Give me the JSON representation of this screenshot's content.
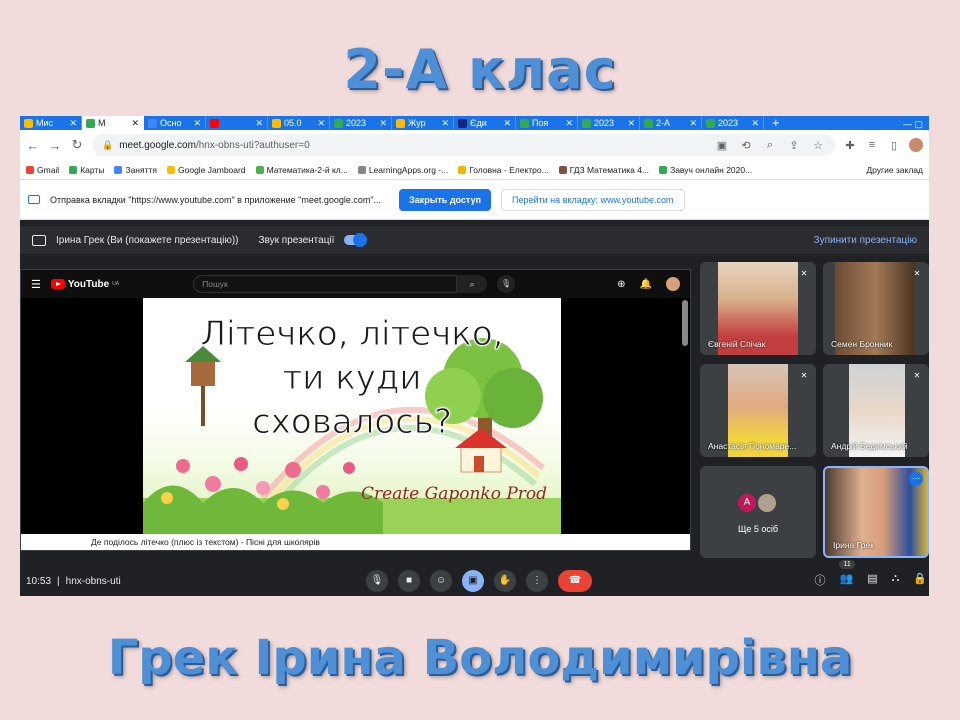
{
  "slide": {
    "title": "2-А клас",
    "footer": "Грек Ірина Володимирівна"
  },
  "browser": {
    "tabs": [
      {
        "label": "Мис",
        "color": "#fbbc04",
        "active": false
      },
      {
        "label": "M",
        "color": "#34a853",
        "active": true
      },
      {
        "label": "Осно",
        "color": "#4285f4",
        "active": false
      },
      {
        "label": "",
        "color": "#ff0000",
        "active": false
      },
      {
        "label": "05.0",
        "color": "#fbbc04",
        "active": false
      },
      {
        "label": "2023",
        "color": "#34a853",
        "active": false
      },
      {
        "label": "Жур",
        "color": "#fbbc04",
        "active": false
      },
      {
        "label": "Єди",
        "color": "#1a237e",
        "active": false
      },
      {
        "label": "Поя",
        "color": "#34a853",
        "active": false
      },
      {
        "label": "2023",
        "color": "#34a853",
        "active": false
      },
      {
        "label": "2-А",
        "color": "#34a853",
        "active": false
      },
      {
        "label": "2023",
        "color": "#34a853",
        "active": false
      }
    ],
    "new_tab": "+",
    "url_domain": "meet.google.com",
    "url_path": "/hnx-obns-uti?authuser=0",
    "bookmarks": [
      {
        "label": "Gmail",
        "color": "#ea4335"
      },
      {
        "label": "Карты",
        "color": "#34a853"
      },
      {
        "label": "Заняття",
        "color": "#4285f4"
      },
      {
        "label": "Google Jamboard",
        "color": "#fbbc04"
      },
      {
        "label": "Математика-2-й кл...",
        "color": "#4caf50"
      },
      {
        "label": "LearningApps.org -...",
        "color": "#888888"
      },
      {
        "label": "Головна - Електро...",
        "color": "#f4b400"
      },
      {
        "label": "ГДЗ Математика 4...",
        "color": "#795548"
      },
      {
        "label": "Завуч онлайн 2020...",
        "color": "#34a853"
      }
    ],
    "bookmarks_other": "Другие заклад"
  },
  "notification": {
    "text": "Отправка вкладки \"https://www.youtube.com\" в приложение \"meet.google.com\"...",
    "share_button": "Закрыть доступ",
    "goto_button": "Перейти на вкладку: www.youtube.com"
  },
  "meet": {
    "presenting_label": "Ірина Грек (Ви (покажете презентацію))",
    "sound_label": "Звук презентації",
    "stop_label": "Зупинити презентацію",
    "time": "10:53",
    "separator": "|",
    "meeting_code": "hnx-obns-uti",
    "participants_count": "11",
    "participants": [
      {
        "name": "Євгеній Спічак"
      },
      {
        "name": "Семен Бронник"
      },
      {
        "name": "Анастасія Пономаре..."
      },
      {
        "name": "Андрій Бедимський"
      },
      {
        "name": "Ірина Грек"
      }
    ],
    "more": {
      "avatar_letter": "A",
      "label": "Ще 5 осіб"
    }
  },
  "youtube": {
    "logo_text": "YouTube",
    "logo_suffix": "UA",
    "search_placeholder": "Пошук",
    "video_title_line1": "Літечко, літечко,",
    "video_title_line2": "ти куди",
    "video_title_line3": "сховалось?",
    "video_credit": "Create Gaponko Prod",
    "caption": "Де поділось літечко (плюс із текстом) - Пісні для школярів"
  },
  "colors": {
    "slide_bg": "#f2dcdb",
    "title_blue": "#4f8fd6",
    "chrome_blue": "#1a73e8",
    "meet_bg": "#202124",
    "hangup_red": "#ea4335"
  }
}
